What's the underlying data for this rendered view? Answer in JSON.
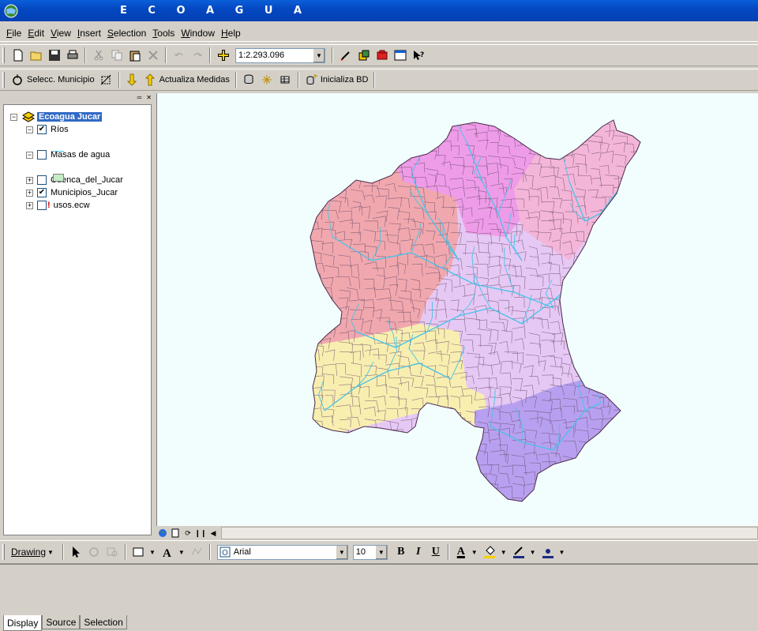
{
  "window": {
    "title": "E C O A G U A"
  },
  "menu": [
    {
      "label": "File",
      "key": "F",
      "rest": "ile"
    },
    {
      "label": "Edit",
      "key": "E",
      "rest": "dit"
    },
    {
      "label": "View",
      "key": "V",
      "rest": "iew"
    },
    {
      "label": "Insert",
      "key": "I",
      "rest": "nsert"
    },
    {
      "label": "Selection",
      "key": "S",
      "rest": "election"
    },
    {
      "label": "Tools",
      "key": "T",
      "rest": "ools"
    },
    {
      "label": "Window",
      "key": "W",
      "rest": "indow"
    },
    {
      "label": "Help",
      "key": "H",
      "rest": "elp"
    }
  ],
  "standard_toolbar": {
    "scale": "1:2.293.096"
  },
  "custom_toolbar": {
    "selecc_label": "Selecc. Municipio",
    "actualiza_label": "Actualiza Medidas",
    "inicializa_label": "Inicializa BD"
  },
  "toc": {
    "frame": "Ecoagua Jucar",
    "layers": [
      {
        "name": "Ríos",
        "checked": true,
        "expanded": true
      },
      {
        "name": "Masas de agua",
        "checked": false,
        "expanded": true
      },
      {
        "name": "Cuenca_del_Jucar",
        "checked": false,
        "expanded": false
      },
      {
        "name": "Municipios_Jucar",
        "checked": true,
        "expanded": false
      },
      {
        "name": "usos.ecw",
        "checked": false,
        "expanded": false,
        "warning": "!"
      }
    ],
    "tabs": [
      "Display",
      "Source",
      "Selection"
    ]
  },
  "drawing_toolbar": {
    "drawing_label": "Drawing",
    "font_name": "Arial",
    "font_size": "10",
    "bold": "B",
    "italic": "I",
    "underline": "U",
    "font_color_glyph": "A"
  },
  "colors": {
    "rivers": "#46c3e8",
    "region_red": "#f0a8ae",
    "region_pink": "#ee9ce8",
    "region_lavender": "#e6c8f4",
    "region_yellow": "#f8eeb0",
    "region_purple": "#b8a0f0"
  }
}
